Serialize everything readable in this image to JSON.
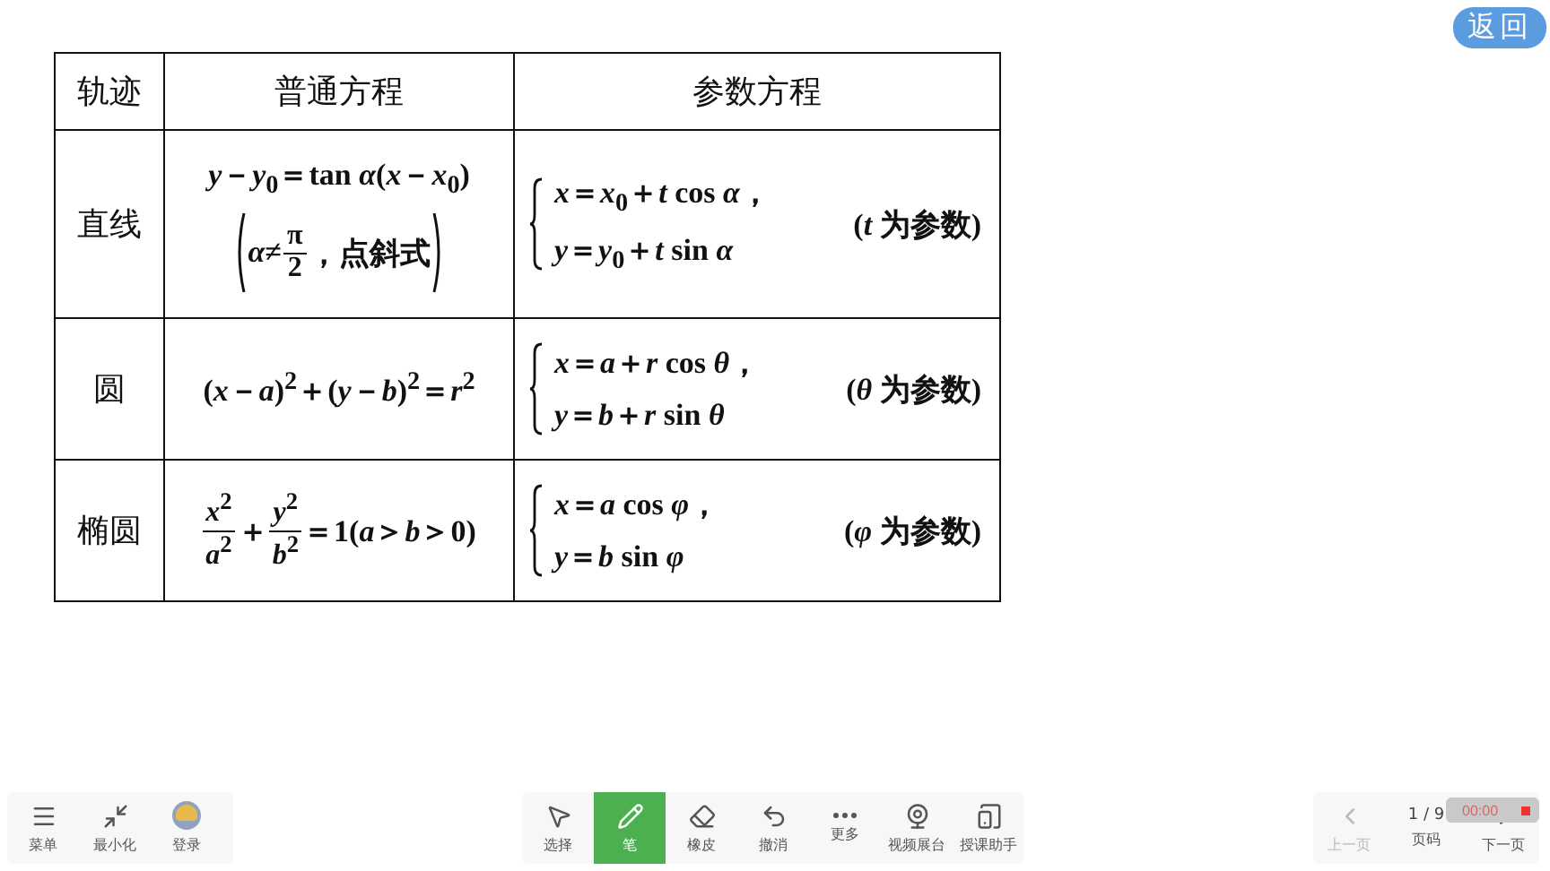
{
  "back_button": "返回",
  "table": {
    "headers": [
      "轨迹",
      "普通方程",
      "参数方程"
    ],
    "rows": [
      {
        "trajectory": "直线",
        "general": [
          [
            {
              "kind": "text",
              "text": "*y*－*y*$_{0}$＝tan *α*(*x*－*x*$_{0}$)"
            }
          ],
          [
            {
              "kind": "paren_open"
            },
            {
              "kind": "text",
              "text": "*α*≠"
            },
            {
              "kind": "frac",
              "num": "π",
              "den": "2"
            },
            {
              "kind": "text",
              "text": "，点斜式"
            },
            {
              "kind": "paren_close"
            }
          ]
        ],
        "param": [
          "*x*＝*x*$_{0}$＋*t* cos *α*，",
          "*y*＝*y*$_{0}$＋*t* sin *α*"
        ],
        "note": "(*t* 为参数)"
      },
      {
        "trajectory": "圆",
        "general": [
          [
            {
              "kind": "text",
              "text": "(*x*－*a*)$^{2}$＋(*y*－*b*)$^{2}$＝*r*$^{2}$"
            }
          ]
        ],
        "param": [
          "*x*＝*a*＋*r* cos *θ*，",
          "*y*＝*b*＋*r* sin *θ*"
        ],
        "note": "(*θ* 为参数)"
      },
      {
        "trajectory": "椭圆",
        "general": [
          [
            {
              "kind": "frac",
              "num": "*x*$^{2}$",
              "den": "*a*$^{2}$"
            },
            {
              "kind": "text",
              "text": "＋"
            },
            {
              "kind": "frac",
              "num": "*y*$^{2}$",
              "den": "*b*$^{2}$"
            },
            {
              "kind": "text",
              "text": "＝1(*a*＞*b*＞0)"
            }
          ]
        ],
        "param": [
          "*x*＝*a* cos *φ*，",
          "*y*＝*b* sin *φ*"
        ],
        "note": "(*φ* 为参数)"
      }
    ]
  },
  "toolbar": {
    "left": [
      {
        "label": "菜单"
      },
      {
        "label": "最小化"
      },
      {
        "label": "登录"
      }
    ],
    "tools": [
      {
        "label": "选择",
        "selected": false
      },
      {
        "label": "笔",
        "selected": true
      },
      {
        "label": "橡皮",
        "selected": false
      },
      {
        "label": "撤消",
        "selected": false
      },
      {
        "label": "更多",
        "selected": false
      },
      {
        "label": "视频展台",
        "selected": false
      },
      {
        "label": "授课助手",
        "selected": false
      }
    ],
    "pager": {
      "prev": {
        "label": "上一页",
        "disabled": true
      },
      "page": "1 / 9",
      "page_label": "页码",
      "next": {
        "label": "下一页",
        "disabled": false
      }
    },
    "timer": "00:00"
  }
}
